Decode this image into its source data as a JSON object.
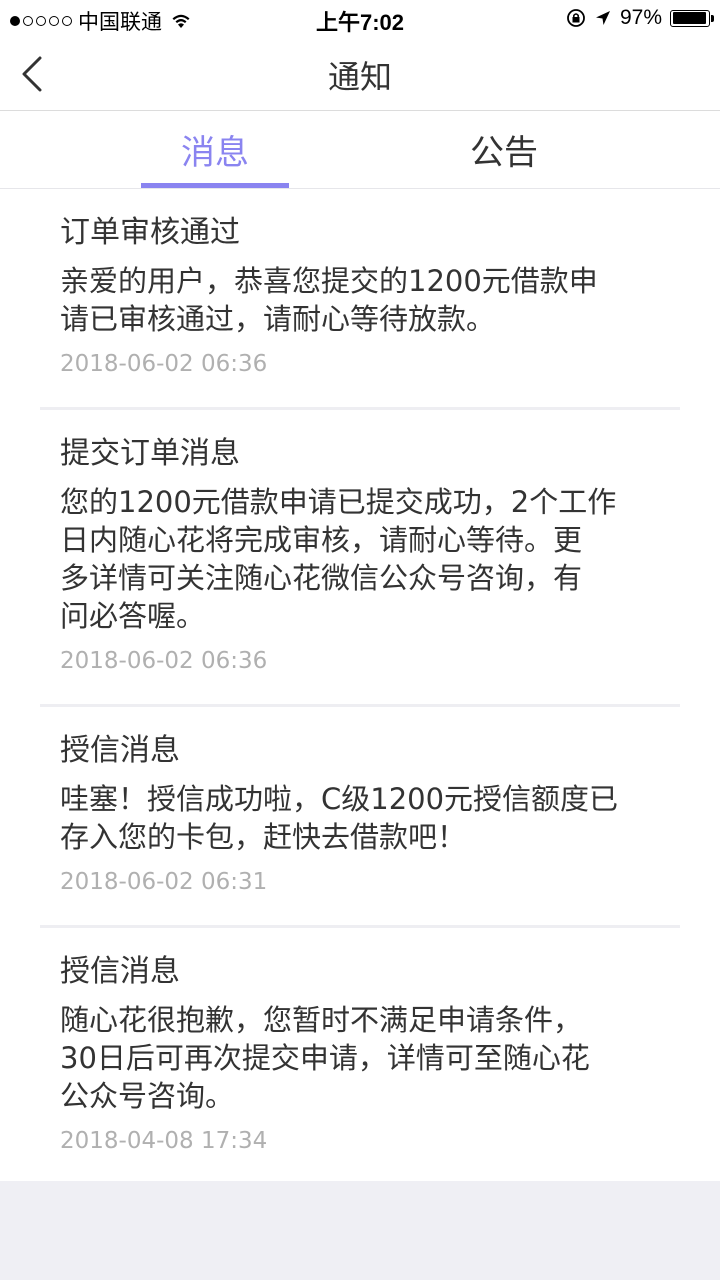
{
  "status_bar": {
    "carrier": "中国联通",
    "time": "上午7:02",
    "battery_percent": "97%",
    "battery_level": 0.97,
    "signal_strength": 1
  },
  "nav": {
    "title": "通知",
    "back_icon": "chevron-left-icon"
  },
  "tabs": {
    "active_color": "#8a84f0",
    "items": [
      {
        "label": "消息",
        "active": true
      },
      {
        "label": "公告",
        "active": false
      }
    ]
  },
  "messages": [
    {
      "title": "订单审核通过",
      "lines": [
        "亲爱的用户，恭喜您提交的1200元借款申",
        "请已审核通过，请耐心等待放款。"
      ],
      "time": "2018-06-02 06:36"
    },
    {
      "title": "提交订单消息",
      "lines": [
        "您的1200元借款申请已提交成功，2个工作",
        "日内随心花将完成审核，请耐心等待。更",
        "多详情可关注随心花微信公众号咨询，有",
        "问必答喔。"
      ],
      "time": "2018-06-02 06:36"
    },
    {
      "title": "授信消息",
      "lines": [
        "哇塞！授信成功啦，C级1200元授信额度已",
        "存入您的卡包，赶快去借款吧！"
      ],
      "time": "2018-06-02 06:31"
    },
    {
      "title": "授信消息",
      "lines": [
        "随心花很抱歉，您暂时不满足申请条件，",
        "30日后可再次提交申请，详情可至随心花",
        "公众号咨询。"
      ],
      "time": "2018-04-08 17:34"
    }
  ]
}
